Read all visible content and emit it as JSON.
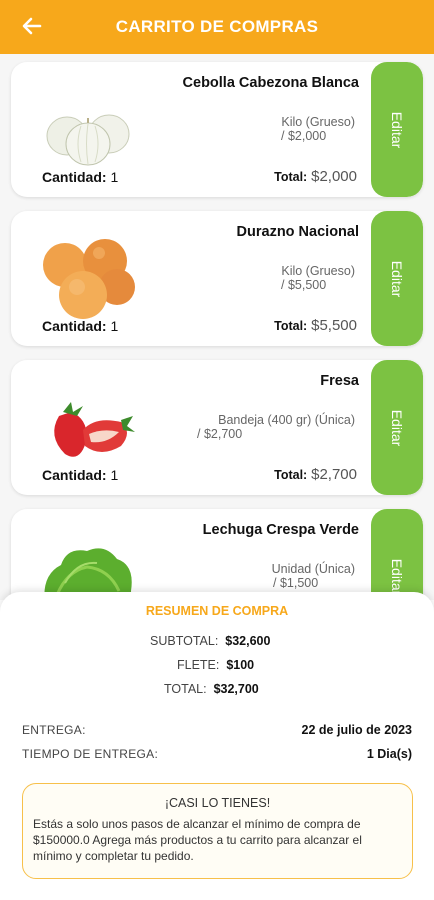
{
  "header": {
    "title": "CARRITO DE COMPRAS",
    "back_icon": "arrow-left-icon"
  },
  "colors": {
    "accent": "#f7a81b",
    "edit": "#7cc242"
  },
  "items": [
    {
      "name": "Cebolla Cabezona Blanca",
      "unit_line1": "Kilo (Grueso)",
      "unit_line2": "/ $2,000",
      "qty_label": "Cantidad:",
      "qty": "1",
      "total_label": "Total:",
      "total": "$2,000",
      "edit": "Editar"
    },
    {
      "name": "Durazno Nacional",
      "unit_line1": "Kilo (Grueso)",
      "unit_line2": "/ $5,500",
      "qty_label": "Cantidad:",
      "qty": "1",
      "total_label": "Total:",
      "total": "$5,500",
      "edit": "Editar"
    },
    {
      "name": "Fresa",
      "unit_line1": "Bandeja (400 gr) (Única)",
      "unit_line2": "/ $2,700",
      "qty_label": "Cantidad:",
      "qty": "1",
      "total_label": "Total:",
      "total": "$2,700",
      "edit": "Editar"
    },
    {
      "name": "Lechuga Crespa Verde",
      "unit_line1": "Unidad (Única)",
      "unit_line2": "/ $1,500",
      "edit": "Editar"
    }
  ],
  "summary": {
    "title": "RESUMEN DE COMPRA",
    "subtotal_label": "SUBTOTAL:",
    "subtotal": "$32,600",
    "flete_label": "FLETE:",
    "flete": "$100",
    "total_label": "TOTAL:",
    "total": "$32,700"
  },
  "delivery": {
    "entrega_label": "ENTREGA:",
    "entrega": "22 de julio de 2023",
    "tiempo_label": "TIEMPO DE ENTREGA:",
    "tiempo": "1 Dia(s)"
  },
  "notice": {
    "title": "¡CASI LO TIENES!",
    "body": "Estás a solo unos pasos de alcanzar el mínimo de compra de $150000.0 Agrega más productos a tu carrito para alcanzar el mínimo y completar tu pedido."
  }
}
